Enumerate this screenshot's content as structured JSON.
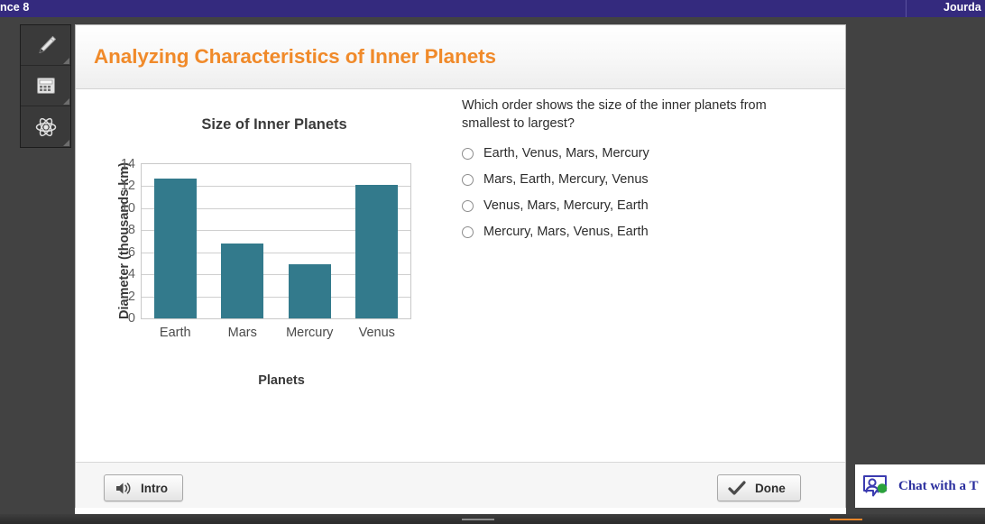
{
  "topbar": {
    "left_text": "nce 8",
    "right_text": "Jourda"
  },
  "toolrail": {
    "items": [
      {
        "name": "highlighter-tool",
        "icon": "pencil-icon"
      },
      {
        "name": "calculator-tool",
        "icon": "calculator-icon"
      },
      {
        "name": "science-tool",
        "icon": "atom-icon"
      }
    ]
  },
  "card": {
    "title": "Analyzing Characteristics of Inner Planets"
  },
  "question": {
    "text": "Which order shows the size of the inner planets from smallest to largest?",
    "options": [
      {
        "label": "Earth, Venus, Mars, Mercury",
        "selected": false
      },
      {
        "label": "Mars, Earth, Mercury, Venus",
        "selected": false
      },
      {
        "label": "Venus, Mars, Mercury, Earth",
        "selected": false
      },
      {
        "label": "Mercury, Mars, Venus, Earth",
        "selected": false
      }
    ]
  },
  "footer": {
    "intro_label": "Intro",
    "intro_icon": "speaker-icon",
    "done_label": "Done",
    "done_icon": "checkmark-icon"
  },
  "chat": {
    "label": "Chat with a T",
    "icon": "chat-person-icon",
    "status_color": "#2ba13c"
  },
  "colors": {
    "topbar": "#342a7e",
    "title_orange": "#f08a2a",
    "bar_teal": "#337a8c",
    "page_dark": "#424242"
  },
  "chart_data": {
    "type": "bar",
    "title": "Size of Inner Planets",
    "xlabel": "Planets",
    "ylabel": "Diameter (thousands km)",
    "categories": [
      "Earth",
      "Mars",
      "Mercury",
      "Venus"
    ],
    "values": [
      12.7,
      6.8,
      4.9,
      12.1
    ],
    "ylim": [
      0,
      14
    ],
    "yticks": [
      0,
      2,
      4,
      6,
      8,
      10,
      12,
      14
    ],
    "grid": true,
    "legend": "none"
  }
}
